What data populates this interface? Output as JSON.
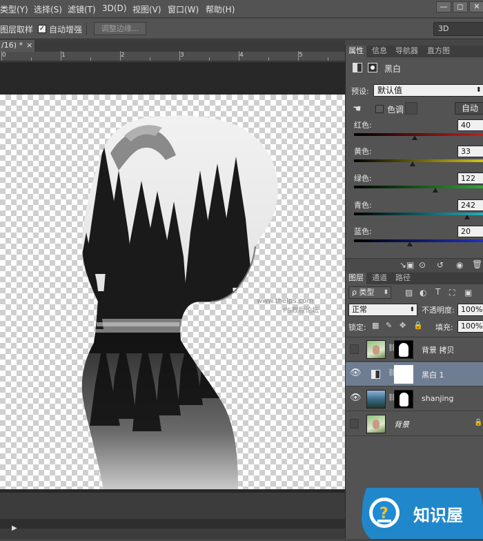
{
  "menu": [
    "类型(Y)",
    "选择(S)",
    "滤镜(T)",
    "3D(D)",
    "视图(V)",
    "窗口(W)",
    "帮助(H)"
  ],
  "window_buttons": [
    "—",
    "◻",
    "✕"
  ],
  "options_bar": {
    "sample_layers_label": "图层取样",
    "auto_enhance_label": "自动增强",
    "refine_edge_button": "调整边缘...",
    "workspace": "3D"
  },
  "document_tab": "/16) *",
  "document_tab_close": "×",
  "ruler_numbers": [
    "0",
    "1",
    "2",
    "3",
    "4",
    "5",
    "6"
  ],
  "properties_panel": {
    "tabs": [
      "属性",
      "信息",
      "导航器",
      "直方图"
    ],
    "adjustment_title": "黑白",
    "preset_label": "预设:",
    "preset_value": "默认值",
    "tint_label": "色调",
    "auto_button": "自动",
    "sliders": [
      {
        "label": "红色:",
        "value": "40",
        "fraction": 0.47
      },
      {
        "label": "黄色:",
        "value": "33",
        "fraction": 0.45
      },
      {
        "label": "绿色:",
        "value": "122",
        "fraction": 0.63
      },
      {
        "label": "青色:",
        "value": "242",
        "fraction": 0.87
      },
      {
        "label": "蓝色:",
        "value": "20",
        "fraction": 0.43
      }
    ]
  },
  "layers_panel": {
    "tabs": [
      "图层",
      "通道",
      "路径"
    ],
    "filter_label": "ρ 类型",
    "blend_mode": "正常",
    "opacity_label": "不透明度:",
    "opacity_value": "100%",
    "lock_label": "锁定:",
    "fill_label": "填充:",
    "fill_value": "100%",
    "layers": [
      {
        "name": "背景 拷贝",
        "visible": false,
        "selected": false
      },
      {
        "name": "黑白 1",
        "visible": true,
        "selected": true
      },
      {
        "name": "shanjing",
        "visible": true,
        "selected": false
      },
      {
        "name": "背景",
        "visible": false,
        "selected": false,
        "locked": true
      }
    ]
  },
  "watermark": {
    "brand": "知识屋",
    "canvas_text_1": "www.thelps.com",
    "canvas_text_2": "PS教程论坛"
  },
  "colors": {
    "red": "#c0201c",
    "yellow": "#d4c418",
    "green": "#2ea832",
    "cyan": "#1fb0c0",
    "blue": "#2030c0",
    "selection": "#6f7d92",
    "brand_blue": "#1d8cd6"
  }
}
